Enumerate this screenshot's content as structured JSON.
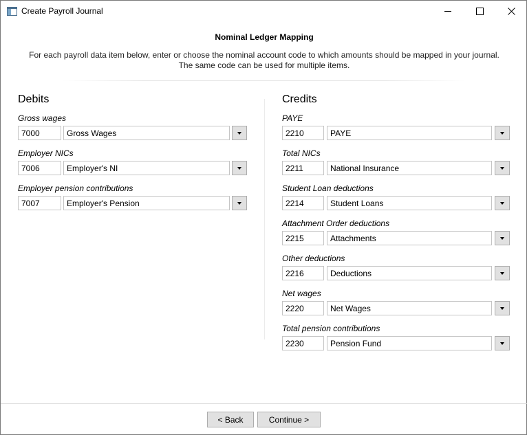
{
  "window": {
    "title": "Create Payroll Journal",
    "icon": "app-window-icon",
    "controls": [
      "minimize-icon",
      "maximize-icon",
      "close-icon"
    ]
  },
  "header": {
    "title": "Nominal Ledger Mapping",
    "description_line1": "For each payroll data item below, enter or choose the nominal account code to which amounts should be mapped in your journal.",
    "description_line2": "The same code can be used for multiple items."
  },
  "debits": {
    "heading": "Debits",
    "items": [
      {
        "label": "Gross wages",
        "code": "7000",
        "name": "Gross Wages"
      },
      {
        "label": "Employer NICs",
        "code": "7006",
        "name": "Employer's NI"
      },
      {
        "label": "Employer pension contributions",
        "code": "7007",
        "name": "Employer's Pension"
      }
    ]
  },
  "credits": {
    "heading": "Credits",
    "items": [
      {
        "label": "PAYE",
        "code": "2210",
        "name": "PAYE"
      },
      {
        "label": "Total NICs",
        "code": "2211",
        "name": "National Insurance"
      },
      {
        "label": "Student Loan deductions",
        "code": "2214",
        "name": "Student Loans"
      },
      {
        "label": "Attachment Order deductions",
        "code": "2215",
        "name": "Attachments"
      },
      {
        "label": "Other deductions",
        "code": "2216",
        "name": "Deductions"
      },
      {
        "label": "Net wages",
        "code": "2220",
        "name": "Net Wages"
      },
      {
        "label": "Total pension contributions",
        "code": "2230",
        "name": "Pension Fund"
      }
    ]
  },
  "footer": {
    "back_label": "< Back",
    "continue_label": "Continue >"
  }
}
